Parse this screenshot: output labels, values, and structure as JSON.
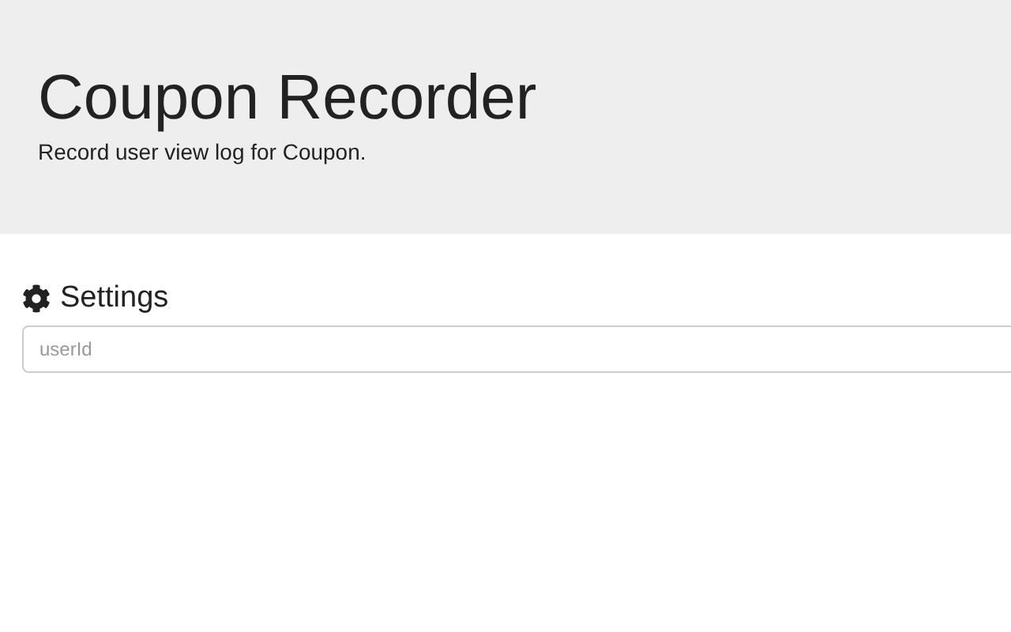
{
  "header": {
    "title": "Coupon Recorder",
    "subtitle": "Record user view log for Coupon."
  },
  "settings": {
    "heading": "Settings",
    "field": {
      "placeholder": "userId"
    }
  }
}
